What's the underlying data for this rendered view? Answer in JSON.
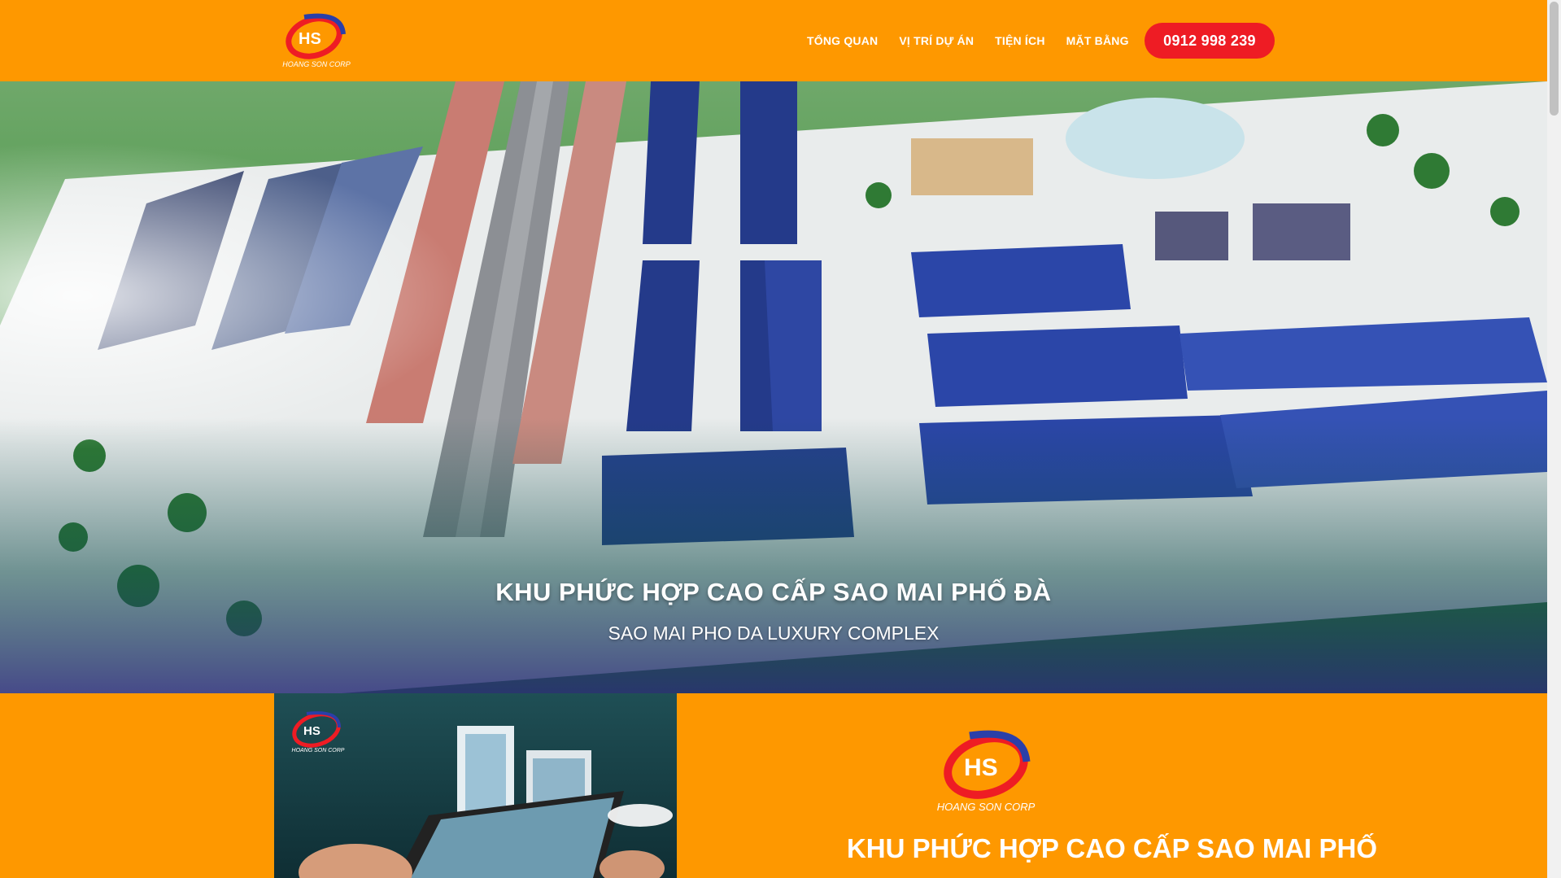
{
  "header": {
    "logo_text": "HS",
    "logo_caption": "HOANG SON CORP",
    "nav": [
      "TỔNG QUAN",
      "VỊ TRÍ DỰ ÁN",
      "TIỆN ÍCH",
      "MẶT BẰNG"
    ],
    "phone": "0912 998 239"
  },
  "hero": {
    "title": "KHU PHỨC HỢP CAO CẤP SAO MAI PHỐ ĐÀ",
    "subtitle": "SAO MAI PHO DA LUXURY COMPLEX"
  },
  "about": {
    "promo_logo_text": "HS",
    "promo_logo_caption": "HOANG SON CORP",
    "logo_text": "HS",
    "logo_caption": "HOANG SON CORP",
    "title": "KHU PHỨC HỢP CAO CẤP SAO MAI PHỐ"
  },
  "colors": {
    "brand_orange": "#fe9800",
    "call_red": "#ee1c24",
    "logo_blue": "#2b3fa8"
  }
}
